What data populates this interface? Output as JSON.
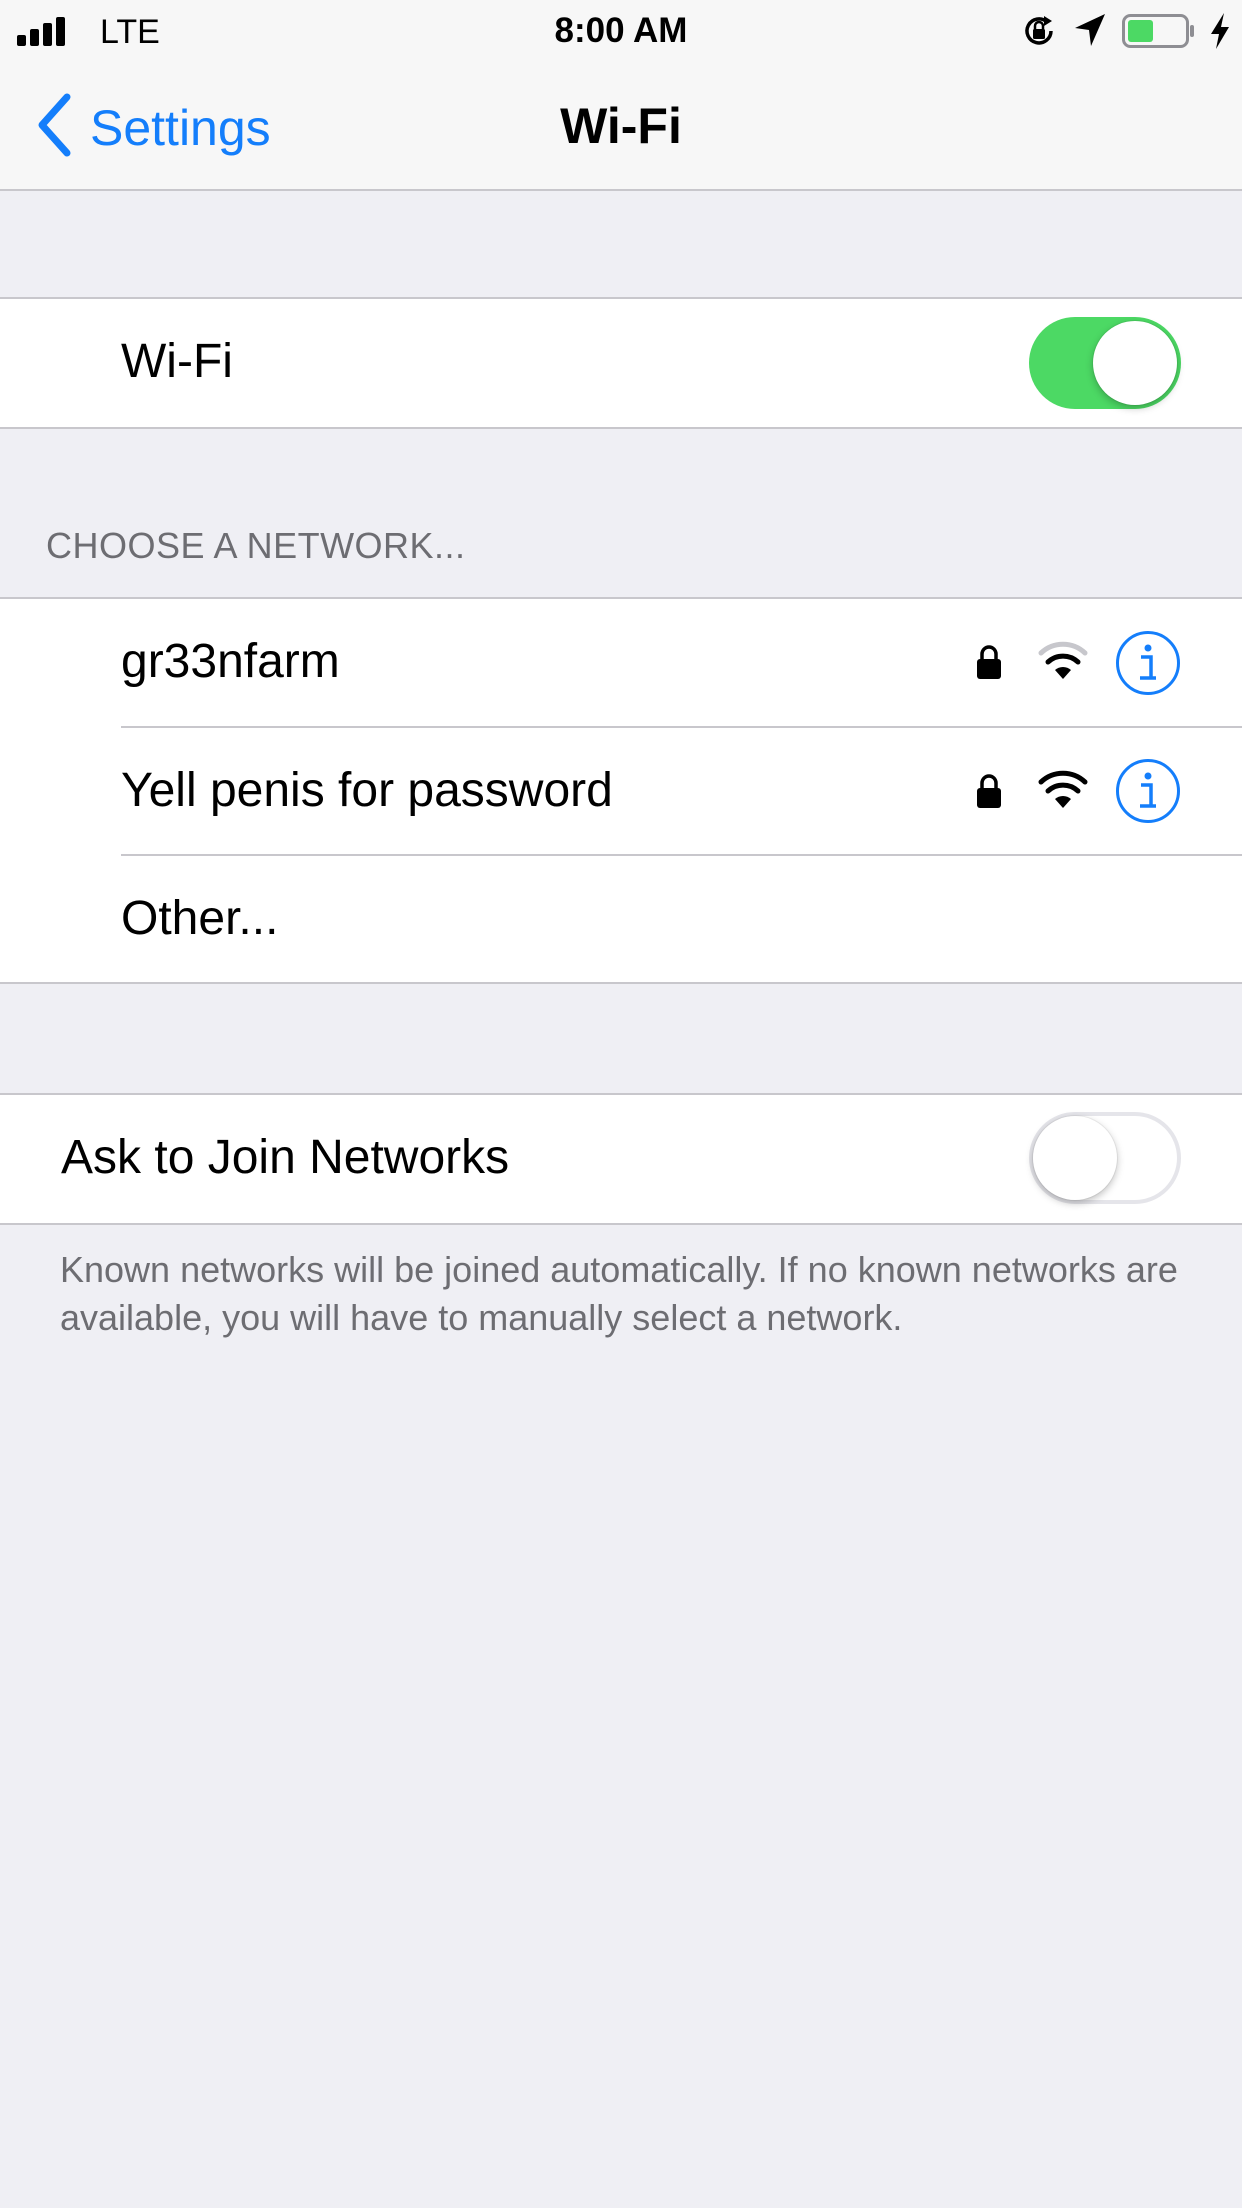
{
  "status_bar": {
    "carrier": "LTE",
    "time": "8:00 AM",
    "signal_bars": 4,
    "battery_level": 0.45,
    "charging": true
  },
  "nav": {
    "back_label": "Settings",
    "title": "Wi-Fi"
  },
  "wifi_toggle": {
    "label": "Wi-Fi",
    "on": true
  },
  "networks": {
    "header": "CHOOSE A NETWORK...",
    "items": [
      {
        "name": "gr33nfarm",
        "secured": true,
        "signal": 2
      },
      {
        "name": "Yell penis for password",
        "secured": true,
        "signal": 3
      }
    ],
    "other_label": "Other..."
  },
  "ask_to_join": {
    "label": "Ask to Join Networks",
    "on": false,
    "footer": "Known networks will be joined automatically. If no known networks are available, you will have to manually select a network."
  },
  "colors": {
    "accent": "#147efb",
    "toggle_on": "#4cd964",
    "battery_fill": "#4cd964",
    "background": "#efeff4"
  }
}
